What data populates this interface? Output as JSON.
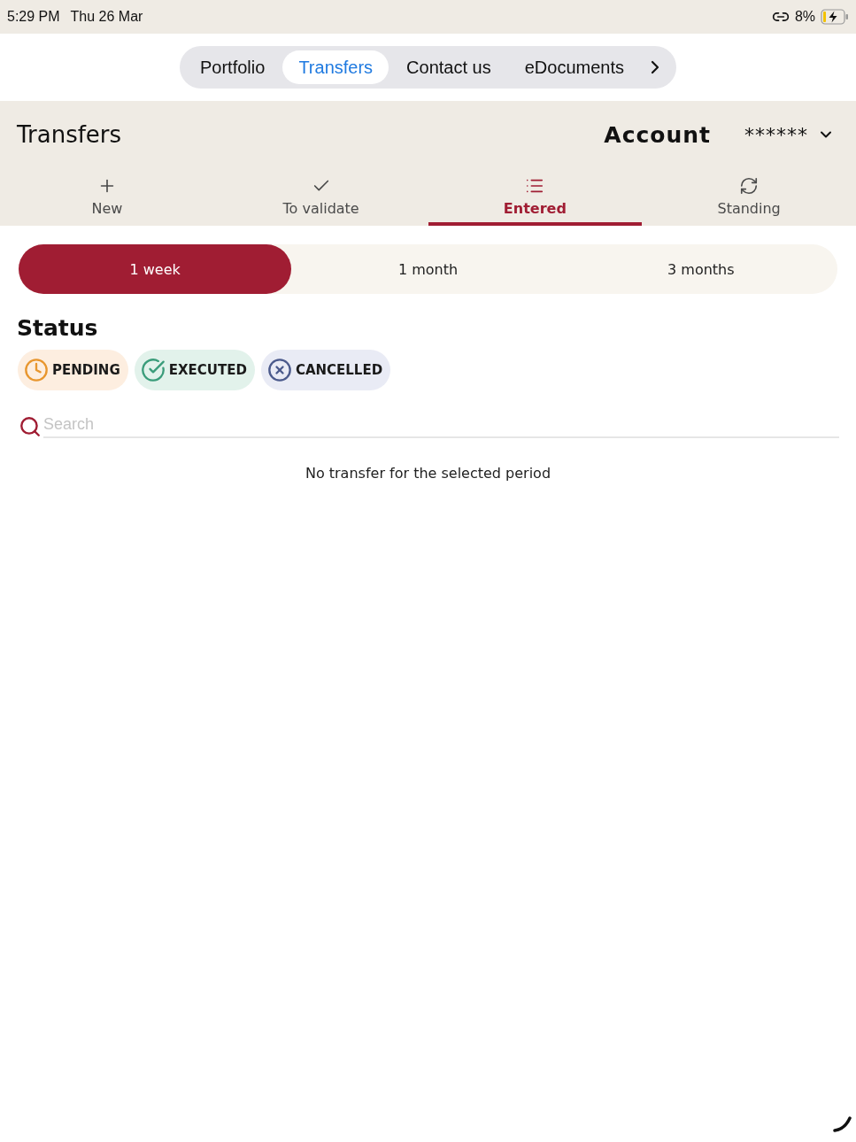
{
  "status_bar": {
    "time": "5:29 PM",
    "date": "Thu 26 Mar",
    "battery": "8%"
  },
  "top_nav": {
    "items": [
      {
        "label": "Portfolio",
        "selected": false
      },
      {
        "label": "Transfers",
        "selected": true
      },
      {
        "label": "Contact us",
        "selected": false
      },
      {
        "label": "eDocuments",
        "selected": false
      }
    ]
  },
  "header": {
    "title": "Transfers",
    "account_label": "Account",
    "account_value": "******"
  },
  "tabs": [
    {
      "label": "New",
      "kind": "new",
      "selected": false
    },
    {
      "label": "To validate",
      "kind": "validate",
      "selected": false
    },
    {
      "label": "Entered",
      "kind": "entered",
      "selected": true
    },
    {
      "label": "Standing",
      "kind": "standing",
      "selected": false
    }
  ],
  "periods": [
    {
      "label": "1 week",
      "selected": true
    },
    {
      "label": "1 month",
      "selected": false
    },
    {
      "label": "3 months",
      "selected": false
    }
  ],
  "status": {
    "heading": "Status",
    "filters": [
      {
        "label": "PENDING",
        "kind": "pending"
      },
      {
        "label": "EXECUTED",
        "kind": "executed"
      },
      {
        "label": "CANCELLED",
        "kind": "cancelled"
      }
    ]
  },
  "search": {
    "placeholder": "Search"
  },
  "empty_message": "No transfer for the selected period"
}
